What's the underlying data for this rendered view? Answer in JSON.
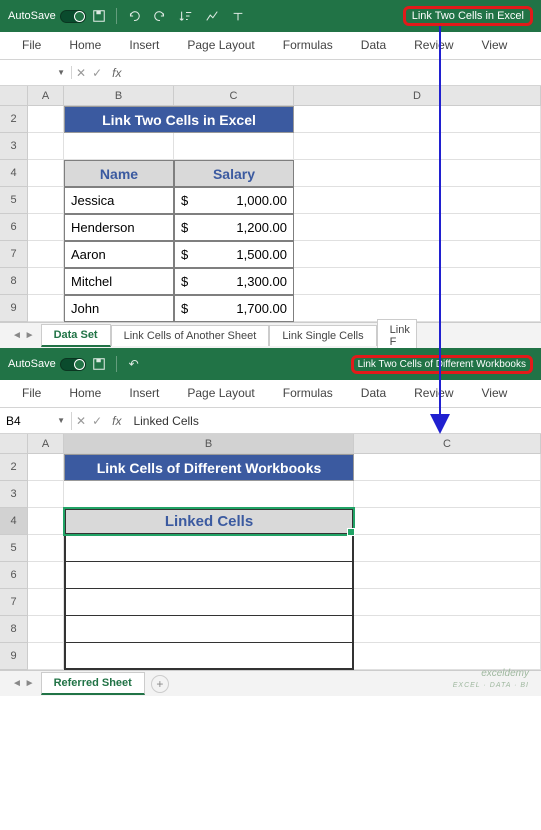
{
  "wb1": {
    "autosave_label": "AutoSave",
    "autosave_state": "On",
    "title": "Link Two Cells in Excel",
    "tabs": [
      "File",
      "Home",
      "Insert",
      "Page Layout",
      "Formulas",
      "Data",
      "Review",
      "View"
    ],
    "banner": "Link Two Cells in Excel",
    "headers": {
      "name": "Name",
      "salary": "Salary"
    },
    "rows": [
      {
        "name": "Jessica",
        "salary": "1,000.00"
      },
      {
        "name": "Henderson",
        "salary": "1,200.00"
      },
      {
        "name": "Aaron",
        "salary": "1,500.00"
      },
      {
        "name": "Mitchel",
        "salary": "1,300.00"
      },
      {
        "name": "John",
        "salary": "1,700.00"
      }
    ],
    "cols": [
      "A",
      "B",
      "C",
      "D"
    ],
    "rownums": [
      "2",
      "3",
      "4",
      "5",
      "6",
      "7",
      "8",
      "9"
    ],
    "sheets": [
      "Data Set",
      "Link Cells of Another Sheet",
      "Link Single Cells",
      "Link F"
    ]
  },
  "wb2": {
    "autosave_label": "AutoSave",
    "autosave_state": "On",
    "title": "Link Two Cells of Different Workbooks",
    "tabs": [
      "File",
      "Home",
      "Insert",
      "Page Layout",
      "Formulas",
      "Data",
      "Review",
      "View"
    ],
    "namebox": "B4",
    "formula": "Linked Cells",
    "banner": "Link Cells of Different Workbooks",
    "linked_header": "Linked Cells",
    "cols": [
      "A",
      "B",
      "C"
    ],
    "rownums": [
      "2",
      "3",
      "4",
      "5",
      "6",
      "7",
      "8",
      "9"
    ],
    "sheets": [
      "Referred Sheet"
    ]
  },
  "currency": "$",
  "watermark": {
    "brand": "exceldemy",
    "tag": "EXCEL · DATA · BI"
  }
}
